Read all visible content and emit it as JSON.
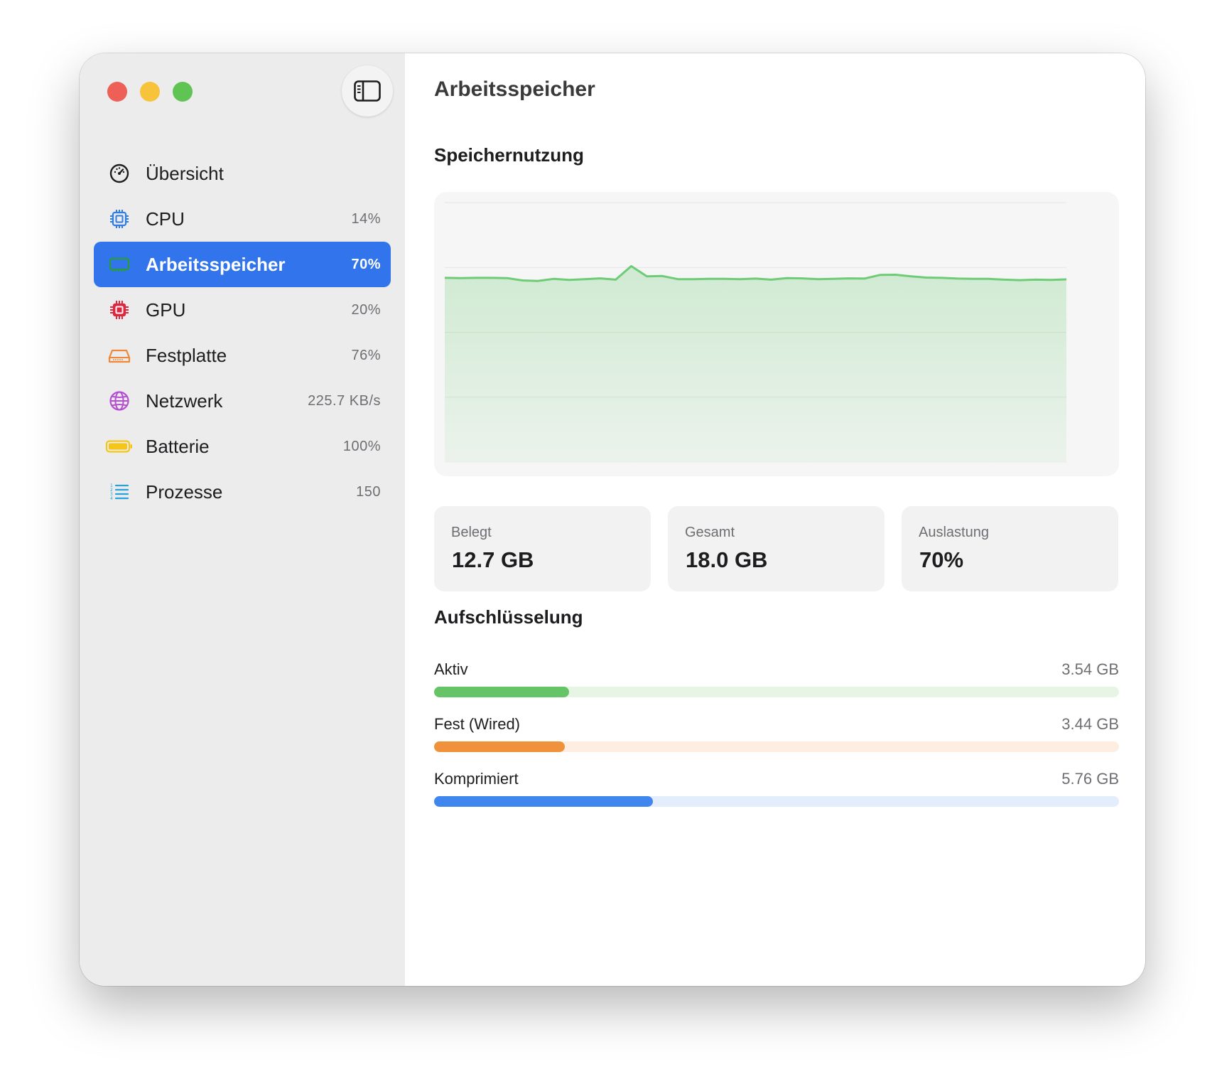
{
  "window": {
    "title": "Arbeitsspeicher"
  },
  "sidebar": {
    "items": [
      {
        "label": "Übersicht",
        "value": "",
        "icon": "gauge-icon",
        "color": "#1d1d1f",
        "active": false
      },
      {
        "label": "CPU",
        "value": "14%",
        "icon": "cpu-icon",
        "color": "#2f7de1",
        "active": false
      },
      {
        "label": "Arbeitsspeicher",
        "value": "70%",
        "icon": "memory-icon",
        "color": "#2a9a47",
        "active": true
      },
      {
        "label": "GPU",
        "value": "20%",
        "icon": "gpu-icon",
        "color": "#e0263f",
        "active": false
      },
      {
        "label": "Festplatte",
        "value": "76%",
        "icon": "disk-icon",
        "color": "#f0883a",
        "active": false
      },
      {
        "label": "Netzwerk",
        "value": "225.7 KB/s",
        "icon": "globe-icon",
        "color": "#b44fd1",
        "active": false
      },
      {
        "label": "Batterie",
        "value": "100%",
        "icon": "battery-icon",
        "color": "#f5c518",
        "active": false
      },
      {
        "label": "Prozesse",
        "value": "150",
        "icon": "list-icon",
        "color": "#2aa1d8",
        "active": false
      }
    ]
  },
  "main": {
    "title": "Arbeitsspeicher",
    "usage_title": "Speichernutzung",
    "breakdown_title": "Aufschlüsselung",
    "stats": [
      {
        "label": "Belegt",
        "value": "12.7 GB"
      },
      {
        "label": "Gesamt",
        "value": "18.0 GB"
      },
      {
        "label": "Auslastung",
        "value": "70%"
      }
    ],
    "breakdown": [
      {
        "label": "Aktiv",
        "value": "3.54 GB",
        "fraction": 0.197,
        "color": "#65c466",
        "track": "#e6f5e4"
      },
      {
        "label": "Fest (Wired)",
        "value": "3.44 GB",
        "fraction": 0.191,
        "color": "#f0923c",
        "track": "#fdeee1"
      },
      {
        "label": "Komprimiert",
        "value": "5.76 GB",
        "fraction": 0.32,
        "color": "#3f86ef",
        "track": "#e4edfb"
      }
    ]
  },
  "chart_data": {
    "type": "area",
    "color": "#6ecb76",
    "ylim": [
      0,
      100
    ],
    "grid": true,
    "values": [
      71,
      70.9,
      71,
      71,
      70.9,
      70,
      69.8,
      70.6,
      70.2,
      70.5,
      70.8,
      70.3,
      75.5,
      71.6,
      71.7,
      70.5,
      70.5,
      70.6,
      70.6,
      70.5,
      70.7,
      70.3,
      70.9,
      70.8,
      70.5,
      70.6,
      70.8,
      70.7,
      72.1,
      72.2,
      71.6,
      71.1,
      71,
      70.7,
      70.6,
      70.6,
      70.3,
      70.1,
      70.3,
      70.2,
      70.4
    ]
  }
}
